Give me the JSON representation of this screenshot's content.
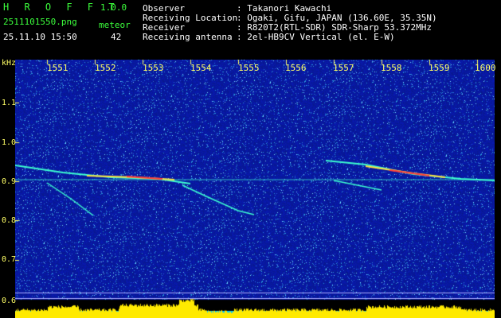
{
  "app": {
    "name": "H R O F F T",
    "version": "1.0.0"
  },
  "file": {
    "name": "2511101550.png",
    "datetime": "25.11.10 15:50"
  },
  "counter": {
    "label": "meteor",
    "value": "42"
  },
  "info": {
    "observer_label": "Observer",
    "observer_value": ": Takanori Kawachi",
    "location_label": "Receiving Location",
    "location_value": ": Ogaki, Gifu, JAPAN (136.60E, 35.35N)",
    "receiver_label": "Receiver",
    "receiver_value": ": R820T2(RTL-SDR) SDR-Sharp 53.372MHz",
    "antenna_label": "Receiving antenna",
    "antenna_value": ": 2el-HB9CV Vertical (el. E-W)"
  },
  "axis": {
    "y_unit": "kHz",
    "y_ticks": [
      "1.1",
      "1.0",
      "0.9",
      "0.8",
      "0.7",
      "0.6"
    ],
    "x_ticks": [
      "1551",
      "1552",
      "1553",
      "1554",
      "1555",
      "1556",
      "1557",
      "1558",
      "1559",
      "1600"
    ]
  },
  "colors": {
    "background": "#000000",
    "noise": "#0a1e9e",
    "tick": "#ffff66",
    "label": "#3cff3c",
    "signal_hot": "#ff3c3c",
    "signal_warm": "#ffe040",
    "signal_cool": "#3cffd0",
    "level_bar": "#ffea00",
    "level_base": "#00c8ff"
  }
}
